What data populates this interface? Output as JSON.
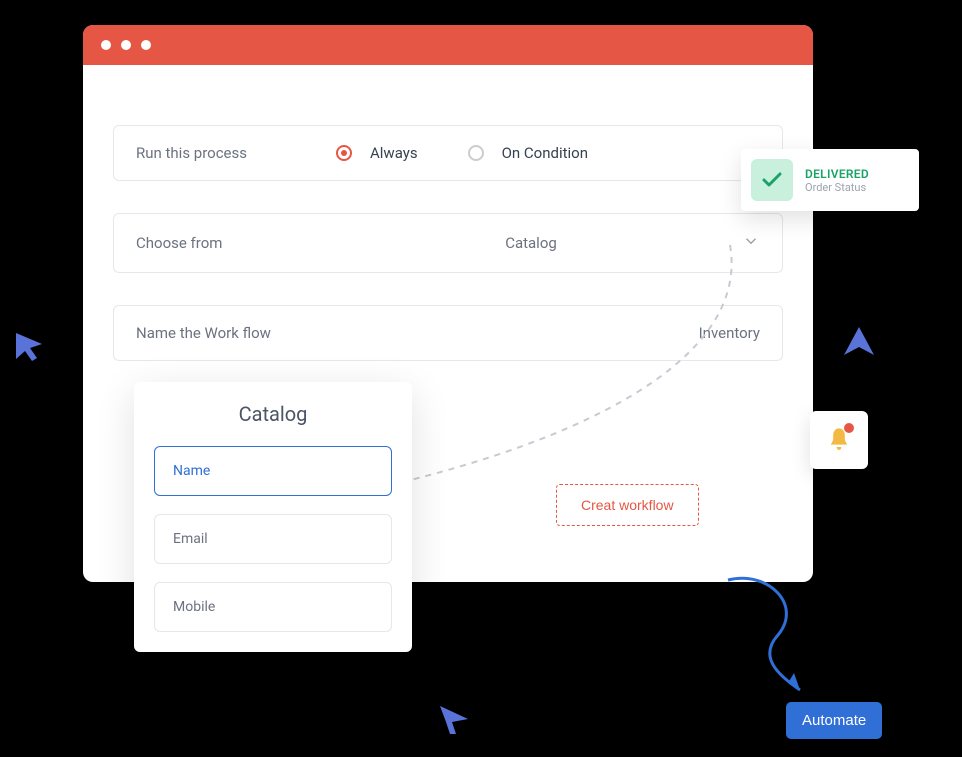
{
  "form": {
    "run_label": "Run this process",
    "option_always": "Always",
    "option_condition": "On Condition",
    "choose_label": "Choose from",
    "choose_value": "Catalog",
    "name_label": "Name the Work flow",
    "name_value": "Inventory"
  },
  "catalog": {
    "title": "Catalog",
    "fields": [
      "Name",
      "Email",
      "Mobile"
    ]
  },
  "create_button": "Creat workflow",
  "delivered": {
    "title": "DELIVERED",
    "subtitle": "Order Status"
  },
  "automate_button": "Automate"
}
